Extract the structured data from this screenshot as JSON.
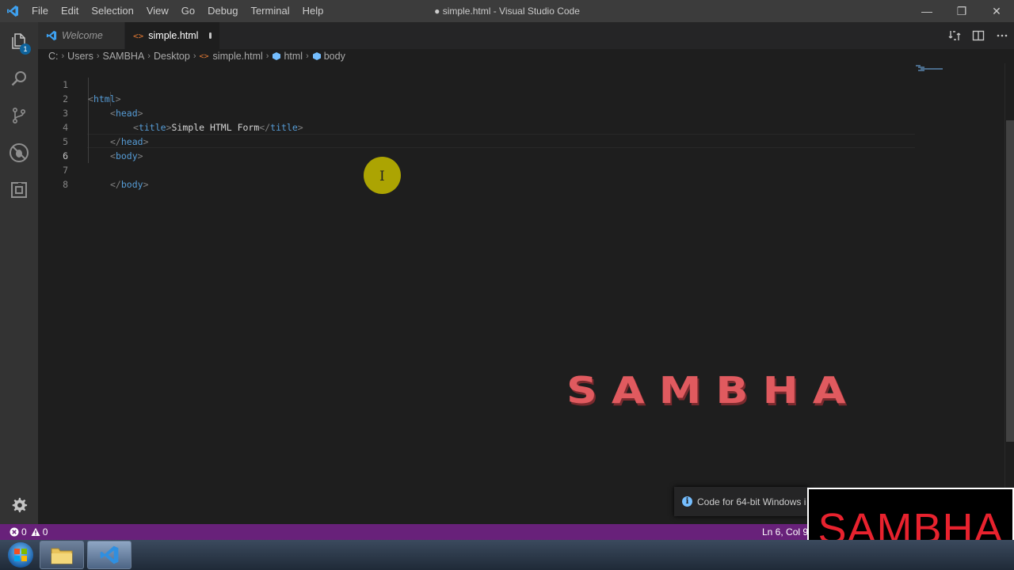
{
  "window": {
    "title": "● simple.html - Visual Studio Code",
    "menu": [
      "File",
      "Edit",
      "Selection",
      "View",
      "Go",
      "Debug",
      "Terminal",
      "Help"
    ],
    "controls": {
      "minimize": "—",
      "restore": "❐",
      "close": "✕"
    }
  },
  "activity": {
    "explorer_badge": "1",
    "icons": [
      "files-icon",
      "search-icon",
      "source-control-icon",
      "debug-icon",
      "extensions-icon"
    ],
    "bottom_icon": "gear-icon"
  },
  "tabs": [
    {
      "label": "Welcome",
      "active": false,
      "italic": true
    },
    {
      "label": "simple.html",
      "active": true,
      "dirty": true
    }
  ],
  "breadcrumb": [
    "C:",
    "Users",
    "SAMBHA",
    "Desktop",
    "simple.html",
    "html",
    "body"
  ],
  "editor": {
    "line_numbers": [
      "1",
      "2",
      "3",
      "4",
      "5",
      "6",
      "7",
      "8"
    ],
    "current_line": "6",
    "lines": {
      "l1": {
        "open": "<",
        "name": "html",
        "close": ">"
      },
      "l2": {
        "open": "<",
        "name": "head",
        "close": ">"
      },
      "l3": {
        "open": "<",
        "name": "title",
        "close": ">",
        "text": "Simple HTML Form",
        "endopen": "</",
        "endname": "title",
        "endclose": ">"
      },
      "l4": {
        "open": "</",
        "name": "head",
        "close": ">"
      },
      "l5": {
        "open": "<",
        "name": "body",
        "close": ">"
      },
      "l7": {
        "open": "</",
        "name": "body",
        "close": ">"
      }
    }
  },
  "watermark": "SAMBHA",
  "notification": {
    "text": "Code for 64-bit Windows i"
  },
  "logo_box": "SAMBHA",
  "status": {
    "errors": "0",
    "warnings": "0",
    "position": "Ln 6, Col 9"
  },
  "colors": {
    "statusbar": "#68217a",
    "editor_bg": "#1e1e1e",
    "tag": "#569cd6",
    "watermark": "#e05a5f",
    "logo": "#e8222e"
  }
}
